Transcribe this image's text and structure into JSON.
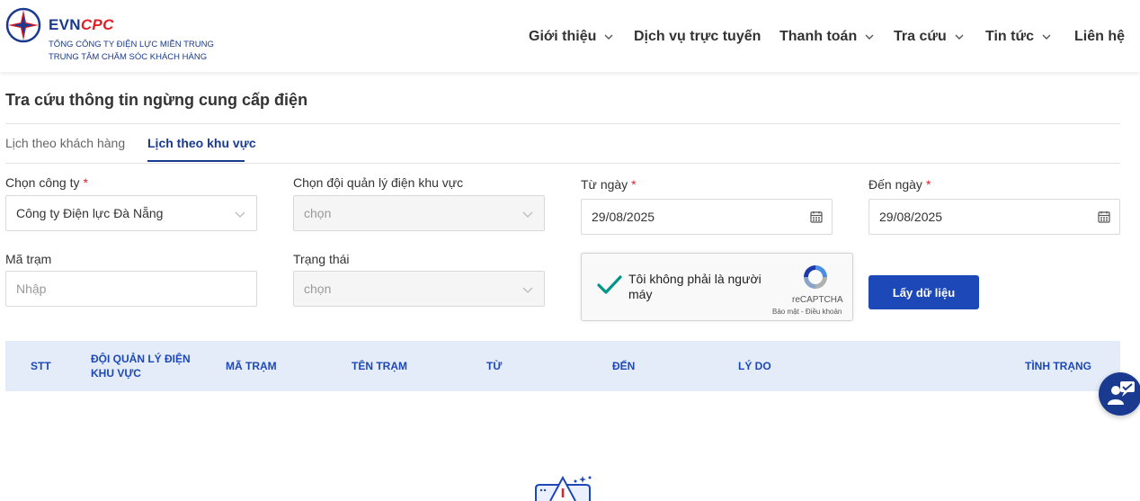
{
  "header": {
    "brand_evn": "EVN",
    "brand_cpc": "CPC",
    "org_line1": "TỔNG CÔNG TY ĐIỆN LỰC MIỀN TRUNG",
    "org_line2": "TRUNG TÂM CHĂM SÓC KHÁCH HÀNG",
    "nav": [
      {
        "label": "Giới thiệu",
        "has_dropdown": true
      },
      {
        "label": "Dịch vụ trực tuyến",
        "has_dropdown": false
      },
      {
        "label": "Thanh toán",
        "has_dropdown": true
      },
      {
        "label": "Tra cứu",
        "has_dropdown": true
      },
      {
        "label": "Tin tức",
        "has_dropdown": true
      },
      {
        "label": "Liên hệ",
        "has_dropdown": false
      }
    ]
  },
  "page": {
    "title": "Tra cứu thông tin ngừng cung cấp điện",
    "tabs": [
      {
        "label": "Lịch theo khách hàng",
        "active": false
      },
      {
        "label": "Lịch theo khu vực",
        "active": true
      }
    ]
  },
  "form": {
    "company": {
      "label": "Chọn công ty",
      "required": "*",
      "value": "Công ty Điện lực Đà Nẵng"
    },
    "team": {
      "label": "Chọn đội quản lý điện khu vực",
      "placeholder": "chọn"
    },
    "from_date": {
      "label": "Từ ngày",
      "required": "*",
      "value": "29/08/2025"
    },
    "to_date": {
      "label": "Đến ngày",
      "required": "*",
      "value": "29/08/2025"
    },
    "station": {
      "label": "Mã trạm",
      "placeholder": "Nhập"
    },
    "status": {
      "label": "Trạng thái",
      "placeholder": "chọn"
    },
    "captcha": {
      "text": "Tôi không phải là người máy",
      "brand": "reCAPTCHA",
      "terms": "Bảo mật - Điều khoản"
    },
    "submit_label": "Lấy dữ liệu"
  },
  "table": {
    "columns": [
      "STT",
      "ĐỘI QUẢN LÝ ĐIỆN KHU VỰC",
      "MÃ TRẠM",
      "TÊN TRẠM",
      "TỪ",
      "ĐẾN",
      "LÝ DO",
      "TÌNH TRẠNG"
    ],
    "team_col_line1": "ĐỘI QUẢN LÝ ĐIỆN",
    "team_col_line2": "KHU VỰC"
  },
  "colors": {
    "primary": "#1d48b7",
    "brand_blue": "#1a3a8f",
    "brand_red": "#e31e24",
    "table_header_bg": "#e4ecfa",
    "captcha_check": "#009688"
  },
  "icons": [
    "evn-logo-icon",
    "chevron-down-icon",
    "calendar-icon",
    "recaptcha-check-icon",
    "recaptcha-logo-icon",
    "chat-support-icon",
    "empty-data-icon"
  ]
}
